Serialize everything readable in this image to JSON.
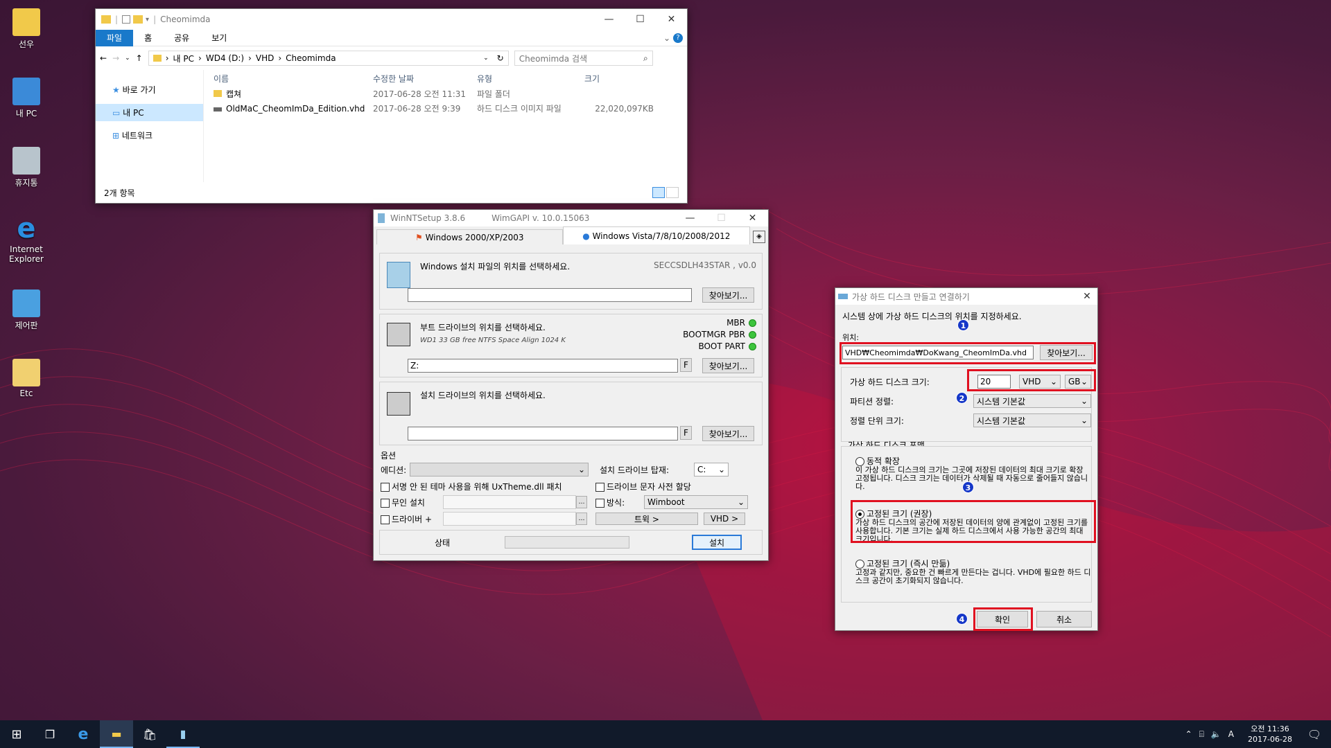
{
  "desktop": {
    "icons": [
      {
        "label": "선우"
      },
      {
        "label": "내 PC"
      },
      {
        "label": "휴지통"
      },
      {
        "label": "Internet Explorer"
      },
      {
        "label": "제어판"
      },
      {
        "label": "Etc"
      }
    ]
  },
  "explorer": {
    "title": "Cheomimda",
    "ribbon": {
      "file": "파일",
      "home": "홈",
      "share": "공유",
      "view": "보기"
    },
    "address": [
      "내 PC",
      "WD4 (D:)",
      "VHD",
      "Cheomimda"
    ],
    "search_placeholder": "Cheomimda 검색",
    "nav": [
      {
        "label": "바로 가기"
      },
      {
        "label": "내 PC"
      },
      {
        "label": "네트워크"
      }
    ],
    "columns": {
      "name": "이름",
      "date": "수정한 날짜",
      "type": "유형",
      "size": "크기"
    },
    "rows": [
      {
        "name": "캡쳐",
        "date": "2017-06-28 오전 11:31",
        "type": "파일 폴더",
        "size": ""
      },
      {
        "name": "OldMaC_CheomImDa_Edition.vhd",
        "date": "2017-06-28 오전 9:39",
        "type": "하드 디스크 이미지 파일",
        "size": "22,020,097KB"
      }
    ],
    "status": "2개 항목"
  },
  "winnt": {
    "title": "WinNTSetup 3.8.6",
    "wimgapi": "WimGAPI v. 10.0.15063",
    "tab1": "Windows 2000/XP/2003",
    "tab2": "Windows Vista/7/8/10/2008/2012",
    "sec1_title": "Windows 설치 파일의 위치를 선택하세요.",
    "sec1_right": "SECCSDLH43STAR , v0.0",
    "browse": "찾아보기...",
    "sec2_title": "부트 드라이브의 위치를 선택하세요.",
    "sec2_sub": "WD1 33 GB free NTFS Space Align 1024 K",
    "sec2_value": "Z:",
    "mbr": "MBR",
    "pbr": "BOOTMGR PBR",
    "bootpart": "BOOT PART",
    "f": "F",
    "sec3_title": "설치 드라이브의 위치를 선택하세요.",
    "options": "옵션",
    "edition": "에디션:",
    "mount_label": "설치 드라이브 탑재:",
    "mount_value": "C:",
    "opt_uxtheme": "서명 안 된 테마 사용을 위해 UxTheme.dll 패치",
    "opt_preassign": "드라이브 문자 사전 할당",
    "opt_unattend": "무인 설치",
    "opt_mode": "방식:",
    "mode_value": "Wimboot",
    "opt_drivers": "드라이버 +",
    "tweaks": "트윅 >",
    "vhd": "VHD >",
    "status": "상태",
    "install": "설치"
  },
  "vhd_dialog": {
    "title": "가상 하드 디스크 만들고 연결하기",
    "intro": "시스템 상에 가상 하드 디스크의 위치를 지정하세요.",
    "location_label": "위치:",
    "location_value": "VHD₩Cheomimda₩DoKwang_CheomImDa.vhd",
    "browse": "찾아보기...",
    "size_label": "가상 하드 디스크 크기:",
    "size_value": "20",
    "type_value": "VHD",
    "unit_value": "GB",
    "partition_label": "파티션 정렬:",
    "partition_value": "시스템 기본값",
    "cluster_label": "정렬 단위 크기:",
    "cluster_value": "시스템 기본값",
    "format_label": "가상 하드 디스크 포맷",
    "dynamic_title": "동적 확장",
    "dynamic_desc": "이 가상 하드 디스크의 크기는 그곳에 저장된 데이터의 최대 크기로 확장 고정됩니다. 디스크 크기는 데이터가 삭제될 때 자동으로 줄어들지 않습니다.",
    "fixed_title": "고정된 크기 (권장)",
    "fixed_desc": "가상 하드 디스크의 공간에 저장된 데이터의 양에 관계없이 고정된 크기를 사용합니다. 기본 크기는 실제 하드 디스크에서 사용 가능한 공간의 최대 크기입니다.",
    "fixedfast_title": "고정된 크기 (즉시 만듦)",
    "fixedfast_desc": "고정과 같지만, 중요한 건 빠르게 만든다는 겁니다. VHD에 필요한 하드 디스크 공간이 초기화되지 않습니다.",
    "ok": "확인",
    "cancel": "취소",
    "n1": "1",
    "n2": "2",
    "n3": "3",
    "n4": "4"
  },
  "taskbar": {
    "time": "오전 11:36",
    "date": "2017-06-28",
    "ime": "A"
  }
}
